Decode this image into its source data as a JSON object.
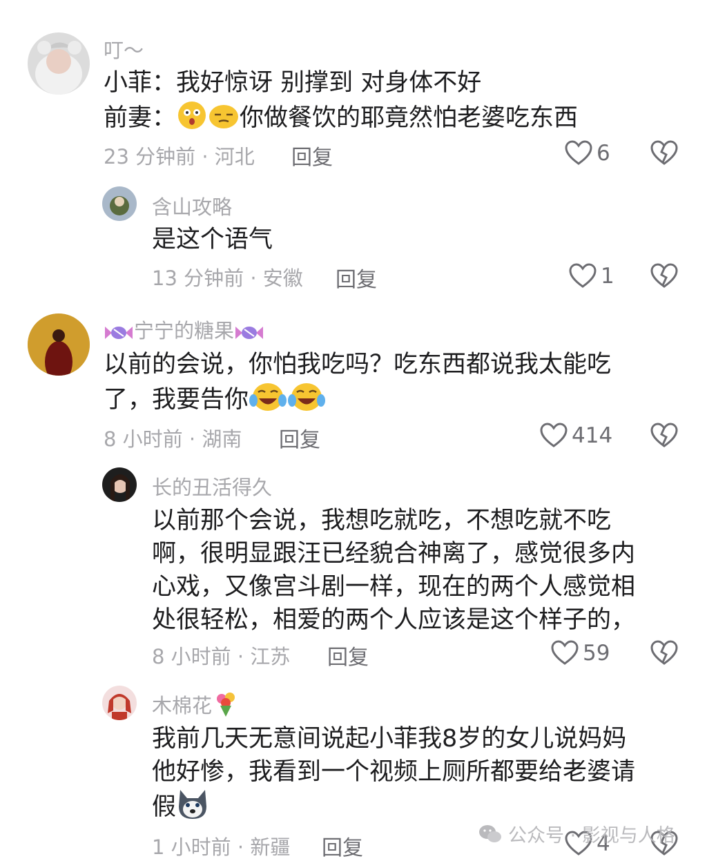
{
  "comments": [
    {
      "user": "叮～",
      "lines": [
        "小菲：我好惊讶 别撑到 对身体不好",
        "前妻：",
        "你做餐饮的耶竟然怕老婆吃东西"
      ],
      "meta": "23 分钟前 · 河北",
      "reply": "回复",
      "likes": "6"
    },
    {
      "user": "含山攻略",
      "lines": [
        "是这个语气"
      ],
      "meta": "13 分钟前 · 安徽",
      "reply": "回复",
      "likes": "1"
    },
    {
      "user": "宁宁的糖果",
      "lines": [
        "以前的会说，你怕我吃吗？吃东西都说我太能吃",
        "了，我要告你"
      ],
      "meta": "8 小时前 · 湖南",
      "reply": "回复",
      "likes": "414"
    },
    {
      "user": "长的丑活得久",
      "lines": [
        "以前那个会说，我想吃就吃，不想吃就不吃",
        "啊，很明显跟汪已经貌合神离了，感觉很多内",
        "心戏，又像宫斗剧一样，现在的两个人感觉相",
        "处很轻松，相爱的两个人应该是这个样子的，"
      ],
      "meta": "8 小时前 · 江苏",
      "reply": "回复",
      "likes": "59"
    },
    {
      "user": "木棉花",
      "lines": [
        "我前几天无意间说起小菲我8岁的女儿说妈妈",
        "他好惨，我看到一个视频上厕所都要给老婆请",
        "假"
      ],
      "meta": "1 小时前 · 新疆",
      "reply": "回复",
      "likes": "4"
    }
  ],
  "icons": {
    "like": "heart-outline-icon",
    "dislike": "broken-heart-icon",
    "emoji_shocked": "shocked-face-emoji",
    "emoji_smirk": "smirk-face-emoji",
    "emoji_laugh": "tears-of-joy-emoji",
    "emoji_dog": "husky-dog-emoji",
    "emoji_candy": "candy-emoji",
    "emoji_flowers": "bouquet-emoji"
  },
  "watermark": {
    "text": "公众号 · 影视与人格"
  },
  "colors": {
    "text": "#1d1d1f",
    "muted": "#a7a7ab",
    "reply": "#6d6d72",
    "background": "#ffffff"
  }
}
